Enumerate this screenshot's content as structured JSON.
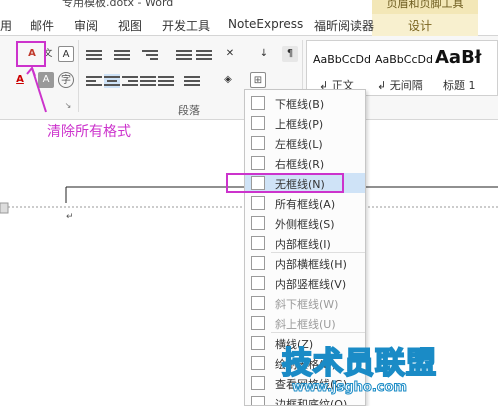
{
  "window": {
    "title": "专用模板.dotx - Word",
    "context_tab_header": "页眉和页脚工具"
  },
  "tabs": [
    {
      "label": "用"
    },
    {
      "label": "邮件"
    },
    {
      "label": "审阅"
    },
    {
      "label": "视图"
    },
    {
      "label": "开发工具"
    },
    {
      "label": "NoteExpress"
    },
    {
      "label": "福昕阅读器"
    },
    {
      "label": "设计"
    }
  ],
  "ribbon": {
    "paragraph_group_label": "段落",
    "styles": [
      {
        "sample": "AaBbCcDd",
        "name": "↲ 正文"
      },
      {
        "sample": "AaBbCcDd",
        "name": "↲ 无间隔"
      },
      {
        "sample": "AaBł",
        "name": "标题 1"
      }
    ]
  },
  "annotation": {
    "text": "清除所有格式",
    "color": "#cc33cc"
  },
  "border_menu": {
    "items": [
      {
        "label": "下框线(B)",
        "disabled": false,
        "selected": false
      },
      {
        "label": "上框线(P)",
        "disabled": false,
        "selected": false
      },
      {
        "label": "左框线(L)",
        "disabled": false,
        "selected": false
      },
      {
        "label": "右框线(R)",
        "disabled": false,
        "selected": false
      },
      {
        "label": "无框线(N)",
        "disabled": false,
        "selected": true
      },
      {
        "label": "所有框线(A)",
        "disabled": false,
        "selected": false
      },
      {
        "label": "外侧框线(S)",
        "disabled": false,
        "selected": false
      },
      {
        "label": "内部框线(I)",
        "disabled": false,
        "selected": false
      },
      {
        "label": "内部横框线(H)",
        "disabled": false,
        "selected": false
      },
      {
        "label": "内部竖框线(V)",
        "disabled": false,
        "selected": false
      },
      {
        "label": "斜下框线(W)",
        "disabled": true,
        "selected": false
      },
      {
        "label": "斜上框线(U)",
        "disabled": true,
        "selected": false
      },
      {
        "label": "横线(Z)",
        "disabled": false,
        "selected": false
      },
      {
        "label": "绘制表格(D)",
        "disabled": false,
        "selected": false
      },
      {
        "label": "查看网格线(G)",
        "disabled": false,
        "selected": false
      },
      {
        "label": "边框和底纹(O)...",
        "disabled": false,
        "selected": false
      }
    ]
  },
  "watermark": {
    "logo": "技术员联盟",
    "url": "www.jsgho.com"
  },
  "colors": {
    "annotation": "#cc33cc",
    "context_tab": "#f3e7b7",
    "selected_item": "#cfe3f7",
    "watermark": "#1a8bc6"
  }
}
